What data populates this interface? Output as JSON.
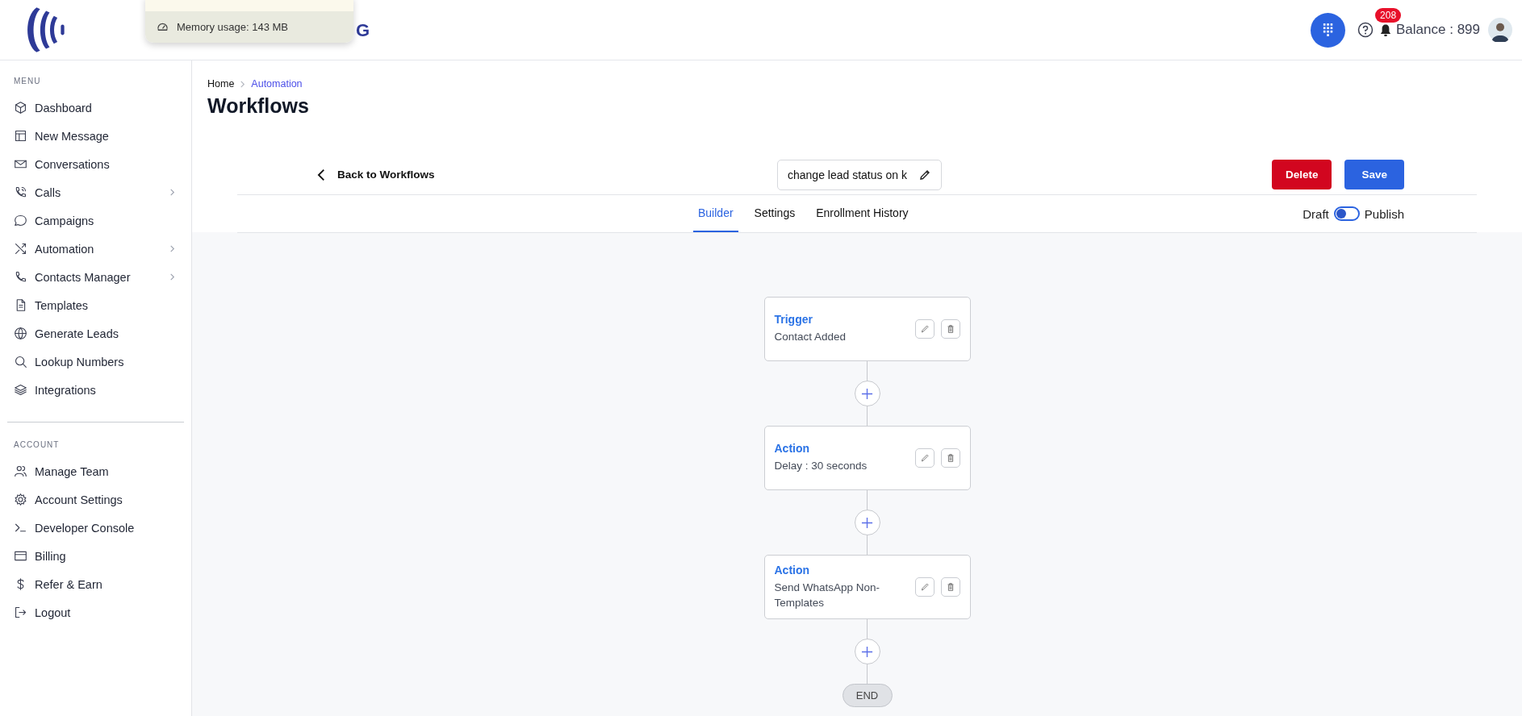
{
  "header": {
    "brand_fragment": "G",
    "memory_tooltip": "Memory usage: 143 MB",
    "notification_count": "208",
    "balance": "Balance : 899"
  },
  "sidebar": {
    "sections": [
      {
        "heading": "MENU",
        "items": [
          {
            "label": "Dashboard",
            "has_submenu": false
          },
          {
            "label": "New Message",
            "has_submenu": false
          },
          {
            "label": "Conversations",
            "has_submenu": false
          },
          {
            "label": "Calls",
            "has_submenu": true
          },
          {
            "label": "Campaigns",
            "has_submenu": false
          },
          {
            "label": "Automation",
            "has_submenu": true
          },
          {
            "label": "Contacts Manager",
            "has_submenu": true
          },
          {
            "label": "Templates",
            "has_submenu": false
          },
          {
            "label": "Generate Leads",
            "has_submenu": false
          },
          {
            "label": "Lookup Numbers",
            "has_submenu": false
          },
          {
            "label": "Integrations",
            "has_submenu": false
          }
        ]
      },
      {
        "heading": "ACCOUNT",
        "items": [
          {
            "label": "Manage Team",
            "has_submenu": false
          },
          {
            "label": "Account Settings",
            "has_submenu": false
          },
          {
            "label": "Developer Console",
            "has_submenu": false
          },
          {
            "label": "Billing",
            "has_submenu": false
          },
          {
            "label": "Refer & Earn",
            "has_submenu": false
          },
          {
            "label": "Logout",
            "has_submenu": false
          }
        ]
      }
    ]
  },
  "breadcrumb": [
    {
      "label": "Home",
      "current": false
    },
    {
      "label": "Automation",
      "current": true
    }
  ],
  "page_title": "Workflows",
  "toolbar": {
    "back": "Back to Workflows",
    "workflow_name": "change lead status on k",
    "delete": "Delete",
    "save": "Save"
  },
  "tabs": [
    {
      "label": "Builder",
      "selected": true
    },
    {
      "label": "Settings",
      "selected": false
    },
    {
      "label": "Enrollment History",
      "selected": false
    }
  ],
  "publish_toggle": {
    "off_label": "Draft",
    "on_label": "Publish",
    "on": false
  },
  "workflow": {
    "nodes": [
      {
        "title": "Trigger",
        "description": "Contact Added"
      },
      {
        "title": "Action",
        "description": "Delay : 30 seconds"
      },
      {
        "title": "Action",
        "description": "Send WhatsApp Non-Templates"
      }
    ],
    "end_label": "END"
  }
}
